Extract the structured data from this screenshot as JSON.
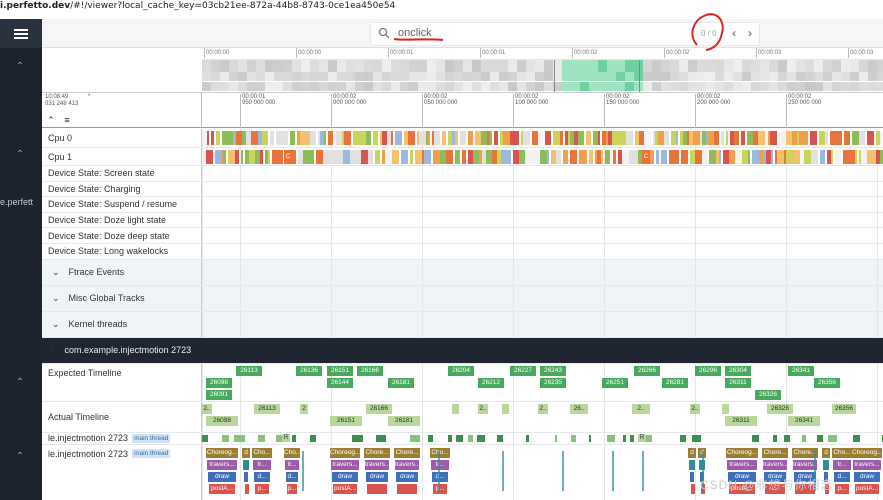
{
  "browser": {
    "url_bold": "i.perfetto.dev",
    "url_rest": "/#!/viewer?local_cache_key=03cb21ee-872a-44b8-8743-0ce1ea450e54"
  },
  "sidebar": {
    "menu_icon": "hamburger-menu-icon",
    "cut_text": "e.perfett"
  },
  "search": {
    "icon": "search-icon",
    "value": "onclick",
    "match_count": "0 / 0",
    "prev_icon": "chevron-left-icon",
    "next_icon": "chevron-right-icon"
  },
  "overview": {
    "ticks": [
      "00:00:00",
      "00:00:00",
      "00:00:01",
      "00:00:01",
      "00:00:02",
      "00:00:02",
      "00:00:03",
      "00:00:03"
    ]
  },
  "ruler": {
    "origin_time": "10:08:49",
    "origin_star": "*",
    "origin_ns": "031 248 413",
    "ticks": [
      {
        "t": "00:00:01",
        "ns": "950 000 000"
      },
      {
        "t": "00:00:02",
        "ns": "000 000 000"
      },
      {
        "t": "00:00:02",
        "ns": "050 000 000"
      },
      {
        "t": "00:00:02",
        "ns": "100 000 000"
      },
      {
        "t": "00:00:02",
        "ns": "150 000 000"
      },
      {
        "t": "00:00:02",
        "ns": "200 000 000"
      },
      {
        "t": "00:00:02",
        "ns": "250 000 000"
      }
    ]
  },
  "tools": {
    "collapse_icon": "collapse-all-icon",
    "list_icon": "list-icon"
  },
  "tracks": {
    "cpu0": "Cpu 0",
    "cpu1": "Cpu 1",
    "cpu_slice_label": "C",
    "device_states": [
      "Device State: Screen state",
      "Device State: Charging",
      "Device State: Suspend / resume",
      "Device State: Doze light state",
      "Device State: Doze deep state",
      "Device State: Long wakelocks"
    ],
    "groups": [
      "Ftrace Events",
      "Misc Global Tracks",
      "Kernel threads"
    ],
    "process": "com.example.injectmotion 2723",
    "expected": "Expected Timeline",
    "actual": "Actual Timeline",
    "thread1": "le.injectmotion 2723",
    "thread2": "le.injectmotion 2723",
    "thread_badge": "main thread"
  },
  "expected_slices": {
    "row1": [
      "26113",
      "26136",
      "26151",
      "26166",
      "26204",
      "26227",
      "26243",
      "26266",
      "26296",
      "26304",
      "26341"
    ],
    "row2": [
      "26098",
      "26144",
      "26181",
      "26212",
      "26235",
      "26251",
      "26281",
      "26311",
      "26356"
    ],
    "row3": [
      "26091",
      "26326"
    ]
  },
  "actual_slices": {
    "row1": [
      "2..",
      "26113",
      "2",
      "26166",
      "2..",
      "2..",
      "26..",
      "2..",
      "2..",
      "26326",
      "26356"
    ],
    "row2": [
      "26098",
      "26151",
      "26181",
      "26311",
      "26341"
    ]
  },
  "thread_slices": {
    "choreo": "Choreog...",
    "choreo_short": "Cho...",
    "choreo_mid": "Chore...",
    "travers": "travers...",
    "tr": "tr...",
    "draw": "draw",
    "d": "d...",
    "post": "postA...",
    "p": "p...",
    "d_short": "d",
    "c": "C",
    "r": "R"
  },
  "watermark": "CSDN @非想与你相恋",
  "colors": {
    "sidebar": "#1d2430",
    "expected": "#48a85c",
    "actual_light": "#b9d79a",
    "annotation": "#e0201b"
  }
}
